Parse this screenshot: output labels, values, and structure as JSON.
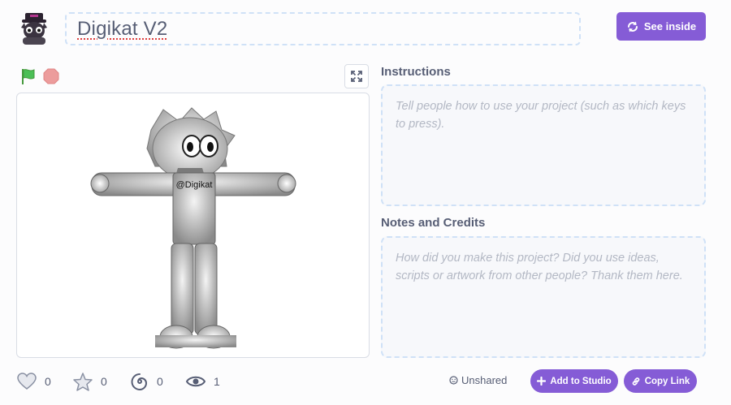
{
  "header": {
    "project_title": "Digikat V2",
    "see_inside_label": "See inside"
  },
  "icons": {
    "avatar": "creator-avatar-icon",
    "see_inside": "remix-arrows-icon",
    "green_flag": "green-flag-icon",
    "stop": "stop-sign-icon",
    "fullscreen": "fullscreen-icon",
    "love": "heart-icon",
    "favorite": "star-icon",
    "remix": "spiral-icon",
    "views": "eye-icon"
  },
  "stage": {
    "sprite_label": "@Digikat"
  },
  "instructions": {
    "heading": "Instructions",
    "placeholder": "Tell people how to use your project (such as which keys to press)."
  },
  "notes": {
    "heading": "Notes and Credits",
    "placeholder": "How did you make this project? Did you use ideas, scripts or artwork from other people? Thank them here."
  },
  "stats": {
    "loves": "0",
    "favorites": "0",
    "remixes": "0",
    "views": "1"
  },
  "share": {
    "status": "Unshared",
    "add_to_studio_label": "Add to Studio",
    "copy_link_label": "Copy Link"
  },
  "colors": {
    "accent": "#855cd6",
    "flag_green": "#4cbf56",
    "stop_red": "#ec9c9c",
    "dashed_border": "#cfe1f7",
    "text": "#575e75",
    "placeholder": "#b3b8c4"
  }
}
